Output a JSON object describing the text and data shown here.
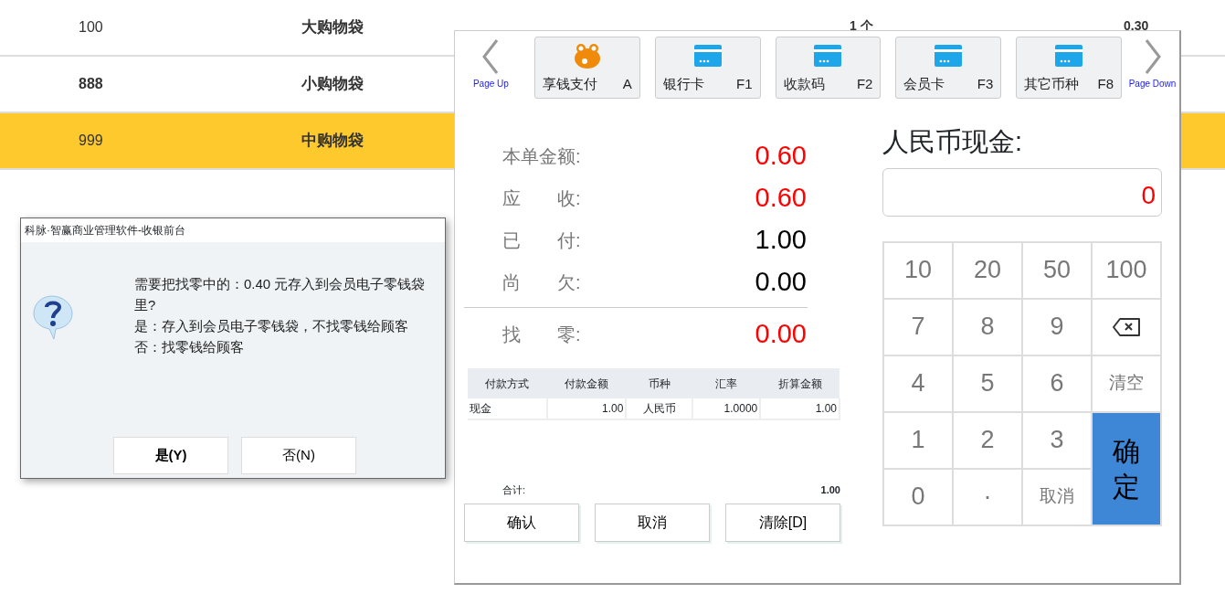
{
  "product_table": {
    "rows": [
      {
        "code": "100",
        "name": "大购物袋",
        "quantity": "1 个",
        "price": "0.30",
        "emphasized": false,
        "selected": false
      },
      {
        "code": "888",
        "name": "小购物袋",
        "emphasized": true,
        "selected": false
      },
      {
        "code": "999",
        "name": "中购物袋",
        "emphasized": false,
        "selected": true
      }
    ]
  },
  "payment_panel": {
    "page_up": "Page Up",
    "page_down": "Page Down",
    "methods": [
      {
        "label": "享钱支付",
        "key": "A",
        "kind": "frog"
      },
      {
        "label": "银行卡",
        "key": "F1",
        "kind": "card"
      },
      {
        "label": "收款码",
        "key": "F2",
        "kind": "card"
      },
      {
        "label": "会员卡",
        "key": "F3",
        "kind": "card"
      },
      {
        "label": "其它币种",
        "key": "F8",
        "kind": "card"
      }
    ],
    "summary": [
      {
        "label": "本单金额:",
        "value": "0.60",
        "alert": true
      },
      {
        "label": "应　　收:",
        "value": "0.60",
        "alert": true
      },
      {
        "label": "已　　付:",
        "value": "1.00",
        "alert": false
      },
      {
        "label": "尚　　欠:",
        "value": "0.00",
        "alert": false
      }
    ],
    "change": {
      "label": "找　　零:",
      "value": "0.00",
      "alert": true
    },
    "payments": {
      "columns": [
        "付款方式",
        "付款金额",
        "币种",
        "汇率",
        "折算金额"
      ],
      "rows": [
        [
          "现金",
          "1.00",
          "人民币",
          "1.0000",
          "1.00"
        ]
      ],
      "total_label": "合计:",
      "total": "1.00"
    },
    "actions": [
      "确认",
      "取消",
      "清除[D]"
    ],
    "cash": {
      "label": "人民币现金:",
      "value": "0"
    },
    "keypad": {
      "rows": [
        [
          {
            "kind": "number",
            "label": "10"
          },
          {
            "kind": "number",
            "label": "20"
          },
          {
            "kind": "number",
            "label": "50"
          },
          {
            "kind": "number",
            "label": "100"
          }
        ],
        [
          {
            "kind": "number",
            "label": "7"
          },
          {
            "kind": "number",
            "label": "8"
          },
          {
            "kind": "number",
            "label": "9"
          },
          {
            "kind": "backspace"
          }
        ],
        [
          {
            "kind": "number",
            "label": "4"
          },
          {
            "kind": "number",
            "label": "5"
          },
          {
            "kind": "number",
            "label": "6"
          },
          {
            "kind": "text",
            "label": "清空"
          }
        ],
        [
          {
            "kind": "number",
            "label": "1"
          },
          {
            "kind": "number",
            "label": "2"
          },
          {
            "kind": "number",
            "label": "3"
          },
          {
            "kind": "confirm",
            "label": "确定"
          }
        ],
        [
          {
            "kind": "number",
            "label": "0"
          },
          {
            "kind": "number",
            "label": "·"
          },
          {
            "kind": "text",
            "label": "取消"
          }
        ]
      ]
    }
  },
  "dialog": {
    "title": "科脉·智赢商业管理软件-收银前台",
    "lines": [
      "需要把找零中的：0.40 元存入到会员电子零钱袋里?",
      "是：存入到会员电子零钱袋，不找零钱给顾客",
      "否：找零钱给顾客"
    ],
    "buttons": [
      {
        "label": "是(Y)",
        "default": true
      },
      {
        "label": "否(N)",
        "default": false
      }
    ]
  }
}
